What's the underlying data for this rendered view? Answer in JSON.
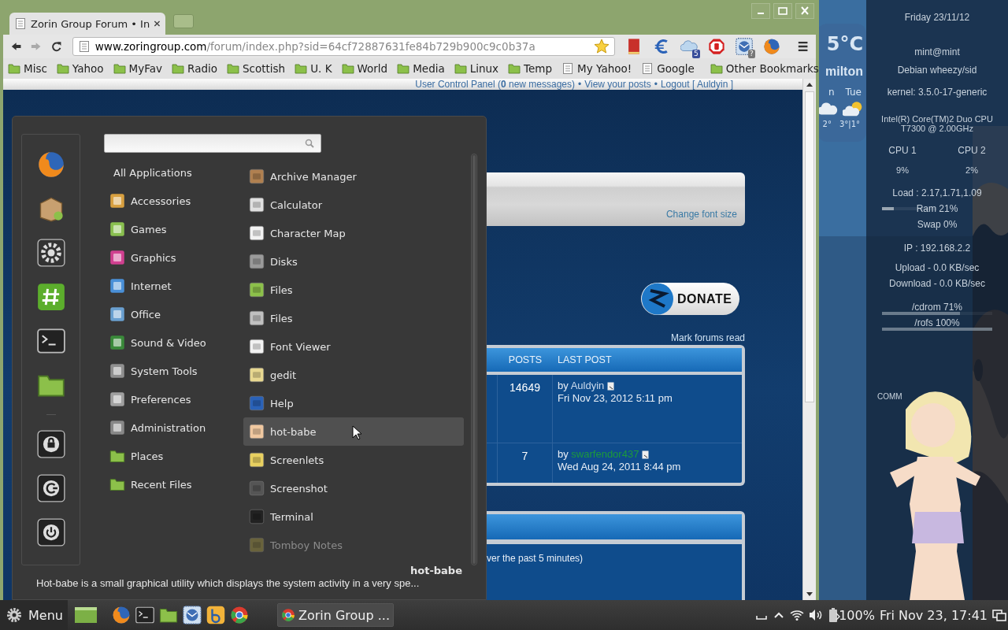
{
  "browser": {
    "tabs": [
      {
        "title": "Zorin Group Forum • In",
        "selected": true
      }
    ],
    "url": {
      "host": "www.zoringroup.com",
      "path": "/forum/index.php?sid=64cf72887631fe84b729b900c9c0b37a"
    },
    "extensions": [
      {
        "kind": "book"
      },
      {
        "kind": "currency"
      },
      {
        "kind": "cloud",
        "badge": "5"
      },
      {
        "kind": "stop"
      },
      {
        "kind": "mail",
        "badge": "?"
      },
      {
        "kind": "globe"
      }
    ],
    "bookmarks": [
      {
        "label": "Misc",
        "kind": "folder"
      },
      {
        "label": "Yahoo",
        "kind": "folder"
      },
      {
        "label": "MyFav",
        "kind": "folder"
      },
      {
        "label": "Radio",
        "kind": "folder"
      },
      {
        "label": "Scottish",
        "kind": "folder"
      },
      {
        "label": "U. K",
        "kind": "folder"
      },
      {
        "label": "World",
        "kind": "folder"
      },
      {
        "label": "Media",
        "kind": "folder"
      },
      {
        "label": "Linux",
        "kind": "folder"
      },
      {
        "label": "Temp",
        "kind": "folder"
      },
      {
        "label": "My Yahoo!",
        "kind": "page"
      },
      {
        "label": "Google",
        "kind": "page"
      }
    ],
    "other_bookmarks": "Other Bookmarks",
    "page": {
      "user_links": [
        "User Control Panel (**0** new messages)",
        "View your posts",
        "Logout [ Auldyin ]"
      ],
      "separator": "•",
      "font_size_link": "Change font size",
      "donate": "DONATE",
      "mark_read": "Mark forums read",
      "table": {
        "columns": [
          "POSTS",
          "LAST POST"
        ],
        "rows": [
          {
            "posts": "14649",
            "by": "by",
            "author": "Auldyin",
            "color": "#c9d9ec",
            "date": "Fri Nov 23, 2012 5:11 pm"
          },
          {
            "posts": "7",
            "by": "by",
            "author": "swarfendor437",
            "color": "#1c9a3c",
            "date": "Wed Aug 24, 2011 8:44 pm"
          }
        ]
      },
      "online_text": "ver the past 5 minutes)"
    }
  },
  "menu": {
    "favorites": [
      {
        "kind": "globe"
      },
      {
        "kind": "package"
      },
      {
        "kind": "gear"
      },
      {
        "kind": "hash"
      },
      {
        "kind": "terminal"
      },
      {
        "kind": "folder"
      },
      {
        "kind": "separator"
      },
      {
        "kind": "lock"
      },
      {
        "kind": "logout"
      },
      {
        "kind": "power"
      }
    ],
    "categories": [
      {
        "label": "All Applications",
        "kind": "all"
      },
      {
        "label": "Accessories",
        "kind": "app"
      },
      {
        "label": "Games",
        "kind": "app"
      },
      {
        "label": "Graphics",
        "kind": "app"
      },
      {
        "label": "Internet",
        "kind": "app"
      },
      {
        "label": "Office",
        "kind": "app"
      },
      {
        "label": "Sound & Video",
        "kind": "app"
      },
      {
        "label": "System Tools",
        "kind": "app"
      },
      {
        "label": "Preferences",
        "kind": "app"
      },
      {
        "label": "Administration",
        "kind": "app"
      },
      {
        "label": "Places",
        "kind": "folder"
      },
      {
        "label": "Recent Files",
        "kind": "folder"
      }
    ],
    "apps": [
      {
        "label": "Archive Manager",
        "selected": false,
        "dimmed": false
      },
      {
        "label": "Calculator",
        "selected": false,
        "dimmed": false
      },
      {
        "label": "Character Map",
        "selected": false,
        "dimmed": false
      },
      {
        "label": "Disks",
        "selected": false,
        "dimmed": false
      },
      {
        "label": "Files",
        "selected": false,
        "dimmed": false
      },
      {
        "label": "Files",
        "selected": false,
        "dimmed": false
      },
      {
        "label": "Font Viewer",
        "selected": false,
        "dimmed": false
      },
      {
        "label": "gedit",
        "selected": false,
        "dimmed": false
      },
      {
        "label": "Help",
        "selected": false,
        "dimmed": false
      },
      {
        "label": "hot-babe",
        "selected": true,
        "dimmed": false
      },
      {
        "label": "Screenlets",
        "selected": false,
        "dimmed": false
      },
      {
        "label": "Screenshot",
        "selected": false,
        "dimmed": false
      },
      {
        "label": "Terminal",
        "selected": false,
        "dimmed": false
      },
      {
        "label": "Tomboy Notes",
        "selected": false,
        "dimmed": true
      }
    ],
    "description": {
      "title": "hot-babe",
      "text": "Hot-babe is a small graphical utility which displays the system activity in a very spe..."
    }
  },
  "weather": {
    "temperature": "5°C",
    "city": "milton",
    "days": [
      "n",
      "Tue"
    ],
    "temps": [
      "2°",
      "3°|1°"
    ]
  },
  "conky": {
    "date": "Friday 23/11/12",
    "user": "mint@mint",
    "os": "Debian wheezy/sid",
    "kernel": "kernel: 3.5.0-17-generic",
    "cpu_model": [
      "Intel(R) Core(TM)2 Duo CPU",
      "T7300  @ 2.00GHz"
    ],
    "cpus": [
      {
        "label": "CPU 1",
        "reading": "9%"
      },
      {
        "label": "CPU 2",
        "reading": "2%"
      }
    ],
    "load": "Load : 2.17,1.71,1.09",
    "ram": {
      "label": "Ram 21%",
      "level": 0.21
    },
    "swap": {
      "label": "Swap 0%"
    },
    "ip": "IP : 192.168.2.2",
    "upload": "Upload - 0.0 KB/sec",
    "download": "Download - 0.0 KB/sec",
    "disks": [
      {
        "label": "/cdrom 71%",
        "level": 0.71
      },
      {
        "label": "/rofs 100%",
        "level": 1
      }
    ],
    "side_text": "COMM"
  },
  "taskbar": {
    "menu_label": "Menu",
    "launchers": [
      {
        "kind": "globe"
      },
      {
        "kind": "terminal"
      },
      {
        "kind": "folder"
      },
      {
        "kind": "mail"
      },
      {
        "kind": "app"
      },
      {
        "kind": "browser"
      }
    ],
    "windows": [
      {
        "title": "Zorin Group ...",
        "selected": false
      }
    ],
    "battery": "100%",
    "clock": "Fri Nov 23, 17:41"
  }
}
